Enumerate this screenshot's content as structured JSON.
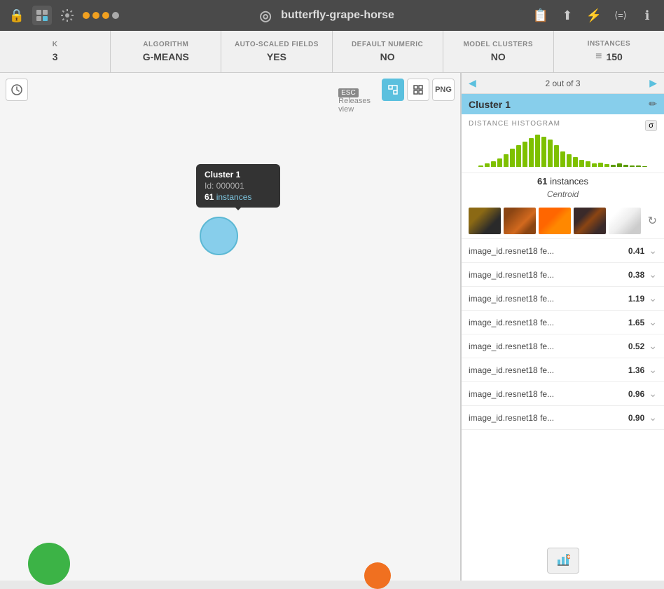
{
  "topbar": {
    "lock_icon": "🔒",
    "network_icon": "⊞",
    "settings_icon": "⚙",
    "title": "butterfly-grape-horse",
    "logo_icon": "◎",
    "clipboard_icon": "📋",
    "upload_icon": "⬆",
    "refresh_icon": "⚡",
    "formula_icon": "⟨=⟩",
    "info_icon": "ℹ",
    "dots": [
      "orange",
      "orange",
      "orange",
      "gray"
    ]
  },
  "stats": [
    {
      "label": "K",
      "value": "3"
    },
    {
      "label": "ALGORITHM",
      "value": "G-MEANS"
    },
    {
      "label": "AUTO-SCALED FIELDS",
      "value": "YES"
    },
    {
      "label": "DEFAULT NUMERIC",
      "value": "NO"
    },
    {
      "label": "MODEL CLUSTERS",
      "value": "NO"
    },
    {
      "label": "INSTANCES",
      "value": "150",
      "icon": "≡"
    }
  ],
  "canvas": {
    "esc_label": "ESC",
    "releases_view": "Releases view"
  },
  "tooltip": {
    "title": "Cluster 1",
    "id_label": "Id: 000001",
    "instances_label": "61 instances"
  },
  "panel": {
    "nav_text": "2 out of 3",
    "cluster_title": "Cluster 1",
    "histogram_label": "DISTANCE HISTOGRAM",
    "instances_count": "61",
    "instances_suffix": " instances",
    "centroid": "Centroid",
    "sigma": "σ",
    "features": [
      {
        "name": "image_id.resnet18 fe...",
        "value": "0.41"
      },
      {
        "name": "image_id.resnet18 fe...",
        "value": "0.38"
      },
      {
        "name": "image_id.resnet18 fe...",
        "value": "1.19"
      },
      {
        "name": "image_id.resnet18 fe...",
        "value": "1.65"
      },
      {
        "name": "image_id.resnet18 fe...",
        "value": "0.52"
      },
      {
        "name": "image_id.resnet18 fe...",
        "value": "1.36"
      },
      {
        "name": "image_id.resnet18 fe...",
        "value": "0.96"
      },
      {
        "name": "image_id.resnet18 fe...",
        "value": "0.90"
      }
    ],
    "chart_icon": "📊"
  },
  "histogram_bars": [
    2,
    5,
    8,
    12,
    18,
    25,
    30,
    35,
    40,
    45,
    42,
    38,
    30,
    22,
    18,
    14,
    10,
    8,
    5,
    6,
    4,
    3,
    5,
    3,
    2,
    2,
    1
  ]
}
